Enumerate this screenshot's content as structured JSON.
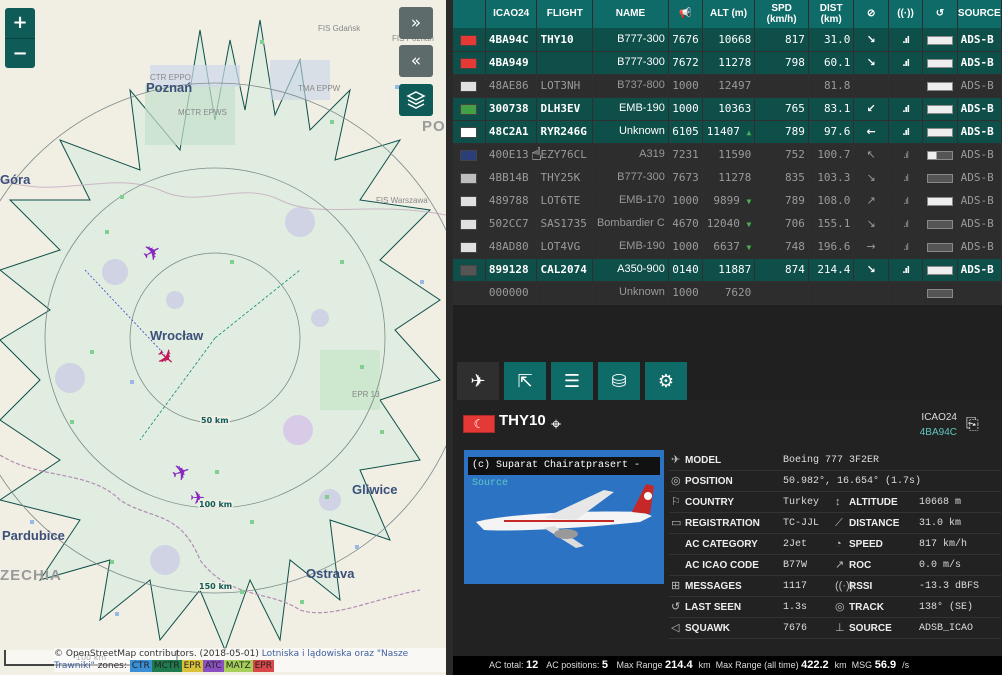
{
  "map": {
    "zoom_in": "+",
    "zoom_out": "−",
    "expand_label": "»",
    "collapse_label": "«",
    "layers_icon": "layers-icon",
    "labels": {
      "fis_gdansk": "FIS Gdańsk",
      "fis_poznan": "FIS Poznań",
      "fis_warszawa": "FIS Warszawa",
      "ctr_epr": "CTR EPPO",
      "poznan": "Poznań",
      "wroclaw": "Wrocław",
      "gliwice": "Gliwice",
      "pardubice": "Pardubice",
      "ostrava": "Ostrava",
      "czechia": "ZECHIA",
      "gora": "Góra",
      "po": "PO",
      "epr": "EPR 13",
      "mctr": "MCTR EPWS",
      "tma": "TMA EPPW"
    },
    "ranges": [
      "50 km",
      "100 km",
      "150 km"
    ],
    "scale": "100 km",
    "attribution": {
      "prefix": "© OpenStreetMap contributors. (2018-05-01)",
      "link": "Lotniska i lądowiska oraz \"Nasze Trawniki\"",
      "zones_label": "zones:",
      "zones": [
        {
          "name": "CTR",
          "color": "#3b8fd6"
        },
        {
          "name": "MCTR",
          "color": "#1f7a4d"
        },
        {
          "name": "EPR",
          "color": "#d9c23a"
        },
        {
          "name": "ATC",
          "color": "#8a4fc0"
        },
        {
          "name": "MATZ",
          "color": "#a6d05a"
        },
        {
          "name": "EPR",
          "color": "#d94848"
        }
      ]
    }
  },
  "table": {
    "headers": [
      "",
      "ICAO24",
      "FLIGHT",
      "NAME",
      "",
      "ALT (m)",
      "SPD (km/h)",
      "DIST (km)",
      "",
      "",
      "",
      "SOURCE"
    ],
    "header_icons": [
      "",
      "",
      "",
      "",
      "megaphone-icon",
      "",
      "",
      "",
      "compass-icon",
      "signal-icon",
      "history-icon",
      ""
    ],
    "rows": [
      {
        "flag": "#e53935",
        "icao": "4BA94C",
        "flight": "THY10",
        "name": "B777-300",
        "squawk": "7676",
        "alt": "10668",
        "trend": "",
        "spd": "817",
        "dist": "31.0",
        "dir": "↘",
        "rssi": ".ıl",
        "bar": "full",
        "source": "ADS-B",
        "state": "active"
      },
      {
        "flag": "#e53935",
        "icao": "4BA949",
        "flight": "",
        "name": "B777-300",
        "squawk": "7672",
        "alt": "11278",
        "trend": "",
        "spd": "798",
        "dist": "60.1",
        "dir": "↘",
        "rssi": ".ıl",
        "bar": "full",
        "source": "ADS-B",
        "state": "active"
      },
      {
        "flag": "#e0e0e0",
        "icao": "48AE86",
        "flight": "LOT3NH",
        "name": "B737-800",
        "squawk": "1000",
        "alt": "12497",
        "trend": "",
        "spd": "",
        "dist": "81.8",
        "dir": "",
        "rssi": "",
        "bar": "full",
        "source": "ADS-B",
        "state": "inactive"
      },
      {
        "flag": "#43a047",
        "icao": "300738",
        "flight": "DLH3EV",
        "name": "EMB-190",
        "squawk": "1000",
        "alt": "10363",
        "trend": "",
        "spd": "765",
        "dist": "83.1",
        "dir": "↙",
        "rssi": ".ıl",
        "bar": "full",
        "source": "ADS-B",
        "state": "active"
      },
      {
        "flag": "#ffffff",
        "icao": "48C2A1",
        "flight": "RYR246G",
        "name": "Unknown",
        "squawk": "6105",
        "alt": "11407",
        "trend": "▲",
        "spd": "789",
        "dist": "97.6",
        "dir": "←",
        "rssi": ".ıl",
        "bar": "full",
        "source": "ADS-B",
        "state": "active"
      },
      {
        "flag": "#2a3f7a",
        "icao": "400E13",
        "flight": "EZY76CL",
        "name": "A319",
        "squawk": "7231",
        "alt": "11590",
        "trend": "",
        "spd": "752",
        "dist": "100.7",
        "dir": "↖",
        "rssi": ".ıl",
        "bar": "part",
        "source": "ADS-B",
        "state": "inactive"
      },
      {
        "flag": "#bdbdbd",
        "icao": "4BB14B",
        "flight": "THY25K",
        "name": "B777-300",
        "squawk": "7673",
        "alt": "11278",
        "trend": "",
        "spd": "835",
        "dist": "103.3",
        "dir": "↘",
        "rssi": ".ıl",
        "bar": "dim",
        "source": "ADS-B",
        "state": "inactive"
      },
      {
        "flag": "#e0e0e0",
        "icao": "489788",
        "flight": "LOT6TE",
        "name": "EMB-170",
        "squawk": "1000",
        "alt": "9899",
        "trend": "▼",
        "spd": "789",
        "dist": "108.0",
        "dir": "↗",
        "rssi": ".ıl",
        "bar": "full",
        "source": "ADS-B",
        "state": "inactive"
      },
      {
        "flag": "#e0e0e0",
        "icao": "502CC7",
        "flight": "SAS1735",
        "name": "Bombardier C",
        "squawk": "4670",
        "alt": "12040",
        "trend": "▼",
        "spd": "706",
        "dist": "155.1",
        "dir": "↘",
        "rssi": ".ıl",
        "bar": "dim",
        "source": "ADS-B",
        "state": "inactive"
      },
      {
        "flag": "#e0e0e0",
        "icao": "48AD80",
        "flight": "LOT4VG",
        "name": "EMB-190",
        "squawk": "1000",
        "alt": "6637",
        "trend": "▼",
        "spd": "748",
        "dist": "196.6",
        "dir": "→",
        "rssi": ".ıl",
        "bar": "dim",
        "source": "ADS-B",
        "state": "inactive"
      },
      {
        "flag": "#555555",
        "icao": "899128",
        "flight": "CAL2074",
        "name": "A350-900",
        "squawk": "0140",
        "alt": "11887",
        "trend": "",
        "spd": "874",
        "dist": "214.4",
        "dir": "↘",
        "rssi": ".ıl",
        "bar": "full",
        "source": "ADS-B",
        "state": "active"
      },
      {
        "flag": "",
        "icao": "000000",
        "flight": "",
        "name": "Unknown",
        "squawk": "1000",
        "alt": "7620",
        "trend": "",
        "spd": "",
        "dist": "",
        "dir": "",
        "rssi": "",
        "bar": "dim",
        "source": "",
        "state": "inactive"
      }
    ]
  },
  "tabs": [
    "plane-icon",
    "external-link-icon",
    "sliders-icon",
    "database-icon",
    "settings-icon"
  ],
  "detail": {
    "flight": "THY10",
    "icao_label": "ICAO24",
    "icao_value": "4BA94C",
    "photo_credit": "(c) Suparat Chairatprasert - ",
    "photo_source": "Source",
    "rows": [
      {
        "l1": "MODEL",
        "i1": "✈",
        "v1": "Boeing 777 3F2ER",
        "l2": "",
        "i2": "",
        "v2": ""
      },
      {
        "l1": "POSITION",
        "i1": "◎",
        "v1": "50.982°, 16.654° (1.7s)",
        "l2": "",
        "i2": "",
        "v2": ""
      },
      {
        "l1": "COUNTRY",
        "i1": "⚐",
        "v1": "Turkey",
        "l2": "ALTITUDE",
        "i2": "↕",
        "v2": "10668 m"
      },
      {
        "l1": "REGISTRATION",
        "i1": "▭",
        "v1": "TC-JJL",
        "l2": "DISTANCE",
        "i2": "⟋",
        "v2": "31.0 km"
      },
      {
        "l1": "AC CATEGORY",
        "i1": "",
        "v1": "2Jet",
        "l2": "SPEED",
        "i2": "◔",
        "v2": "817 km/h"
      },
      {
        "l1": "AC ICAO CODE",
        "i1": "",
        "v1": "B77W",
        "l2": "ROC",
        "i2": "↗",
        "v2": "0.0 m/s"
      },
      {
        "l1": "MESSAGES",
        "i1": "⊞",
        "v1": "1117",
        "l2": "RSSI",
        "i2": "((·))",
        "v2": "-13.3 dBFS"
      },
      {
        "l1": "LAST SEEN",
        "i1": "↺",
        "v1": "1.3s",
        "l2": "TRACK",
        "i2": "◎",
        "v2": "138° (SE)"
      },
      {
        "l1": "SQUAWK",
        "i1": "◁",
        "v1": "7676",
        "l2": "SOURCE",
        "i2": "⊥",
        "v2": "ADSB_ICAO"
      }
    ]
  },
  "footer": {
    "ac_total_label": "AC total:",
    "ac_total": "12",
    "ac_pos_label": "AC positions:",
    "ac_pos": "5",
    "max_range_label": "Max Range",
    "max_range": "214.4",
    "max_range_all_label": "Max Range (all time)",
    "max_range_all": "422.2",
    "unit_km": "km",
    "msg_label": "MSG",
    "msg": "56.9",
    "msg_unit": "/s"
  }
}
